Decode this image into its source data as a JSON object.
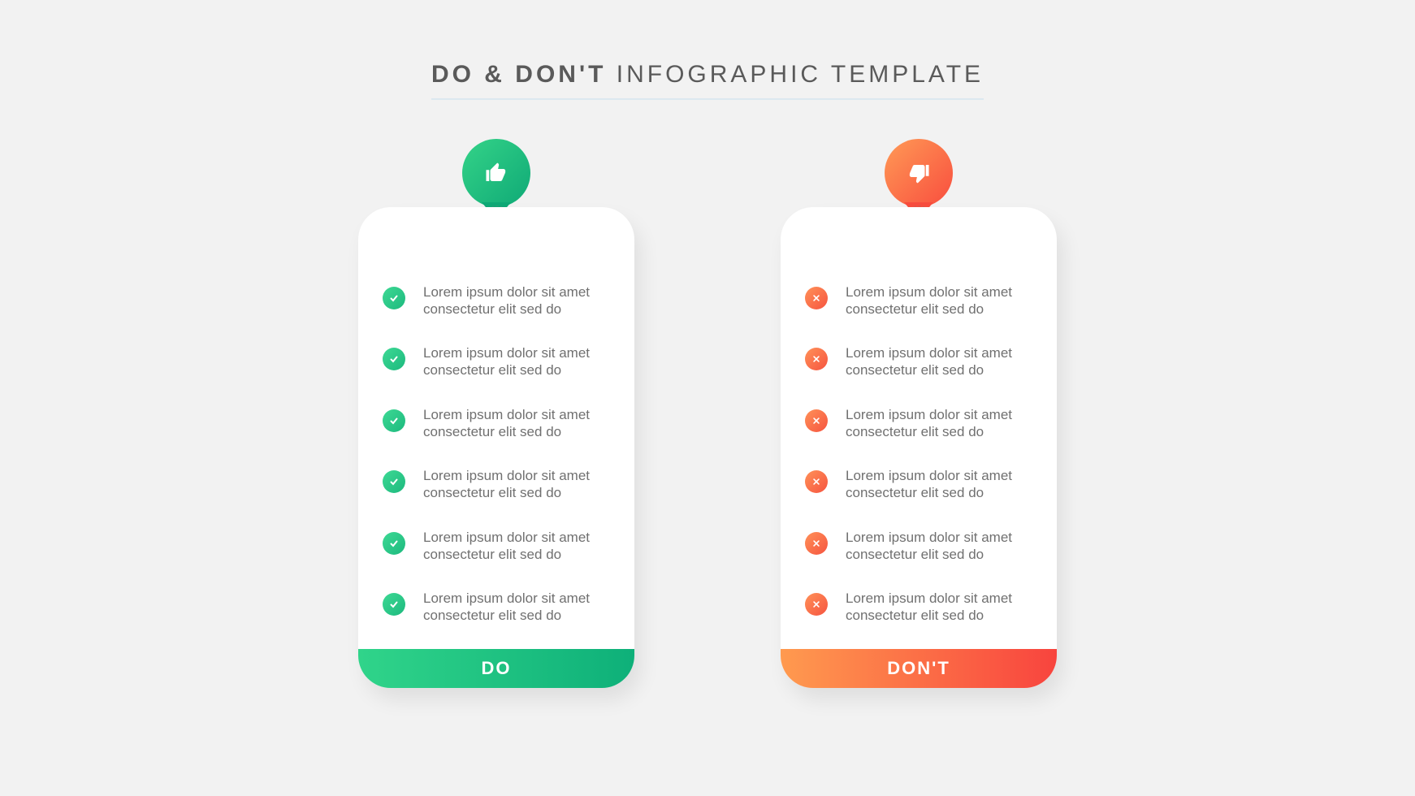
{
  "header": {
    "bold": "DO & DON'T",
    "light": " INFOGRAPHIC TEMPLATE"
  },
  "do_card": {
    "footer": "DO",
    "items": [
      "Lorem ipsum dolor sit amet consectetur elit sed do",
      "Lorem ipsum dolor sit amet consectetur elit sed do",
      "Lorem ipsum dolor sit amet consectetur elit sed do",
      "Lorem ipsum dolor sit amet consectetur elit sed do",
      "Lorem ipsum dolor sit amet consectetur elit sed do",
      "Lorem ipsum dolor sit amet consectetur elit sed do"
    ]
  },
  "dont_card": {
    "footer": "DON'T",
    "items": [
      "Lorem ipsum dolor sit amet consectetur elit sed do",
      "Lorem ipsum dolor sit amet consectetur elit sed do",
      "Lorem ipsum dolor sit amet consectetur elit sed do",
      "Lorem ipsum dolor sit amet consectetur elit sed do",
      "Lorem ipsum dolor sit amet consectetur elit sed do",
      "Lorem ipsum dolor sit amet consectetur elit sed do"
    ]
  }
}
